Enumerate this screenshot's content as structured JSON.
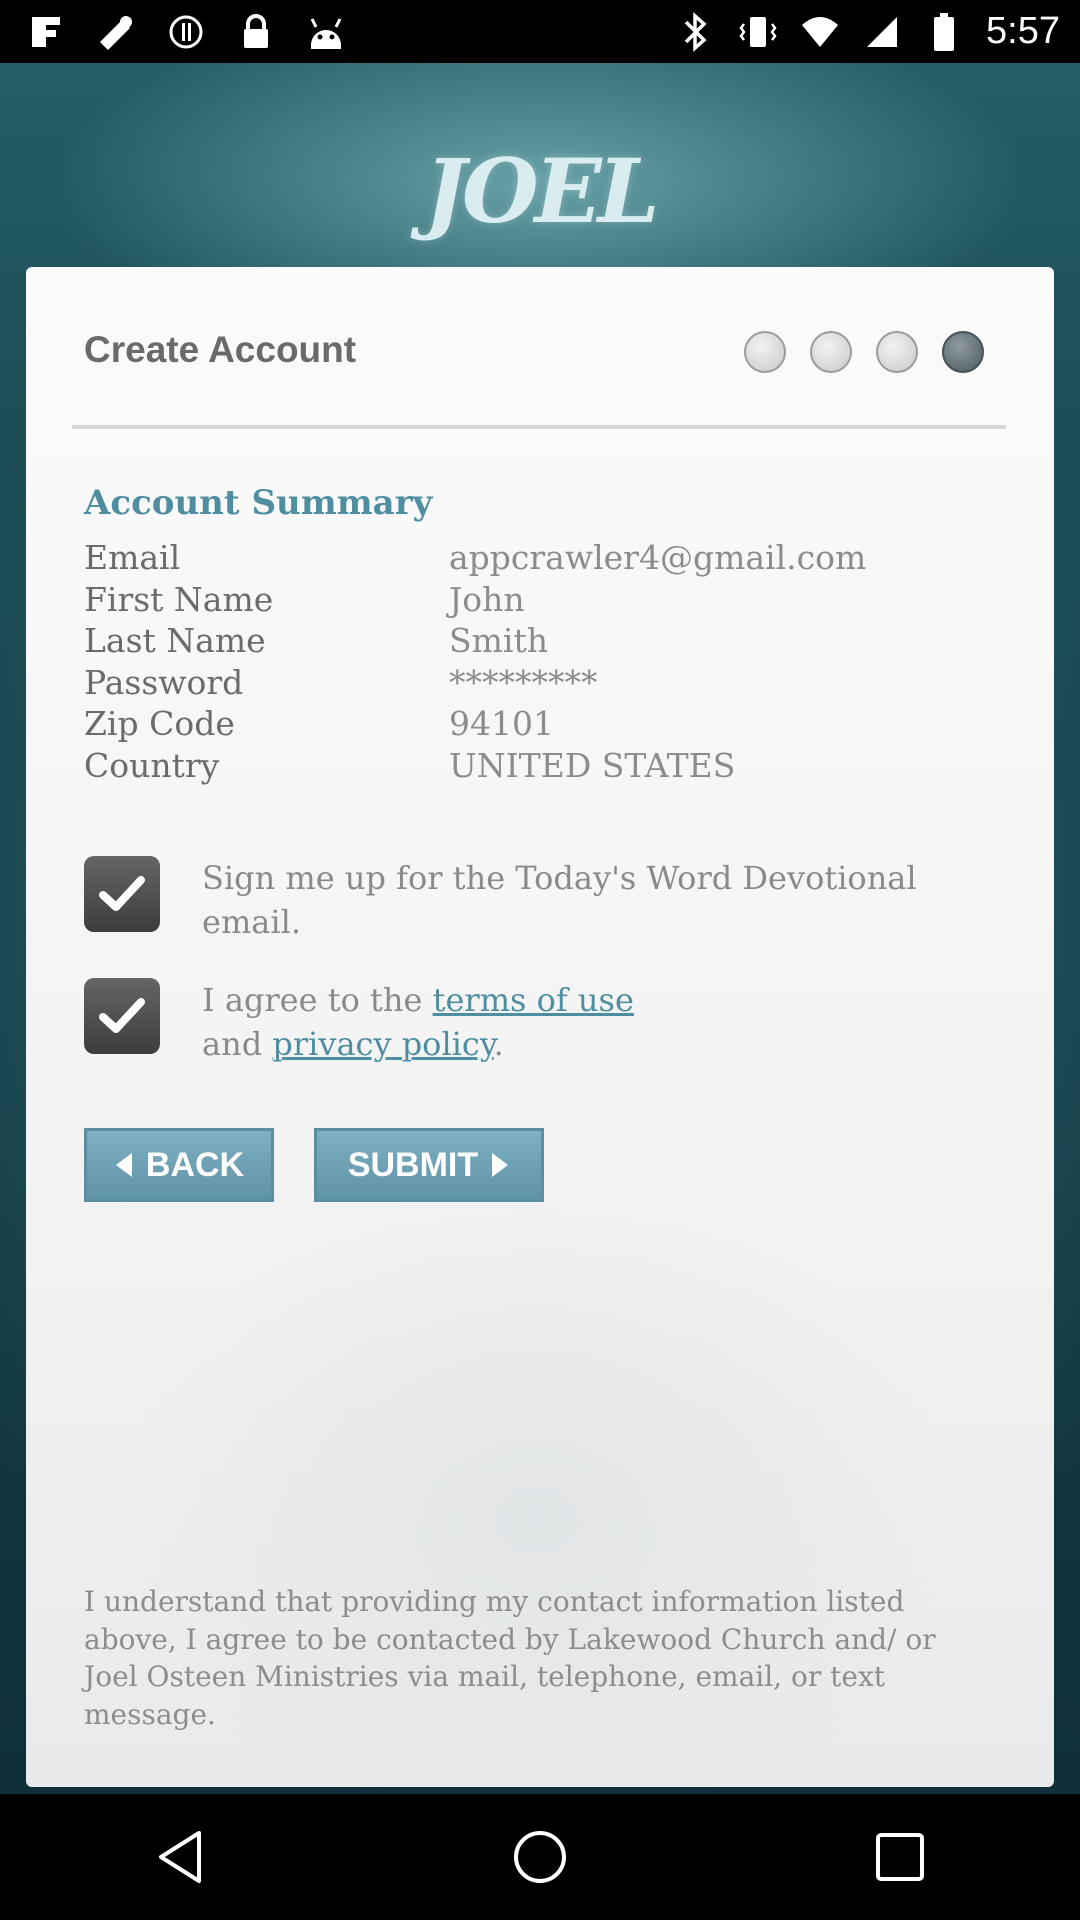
{
  "status_bar": {
    "time": "5:57"
  },
  "app": {
    "logo_text": "JOEL"
  },
  "header": {
    "title": "Create Account",
    "steps_total": 4,
    "current_step": 4
  },
  "summary": {
    "heading": "Account Summary",
    "rows": [
      {
        "label": "Email",
        "value": "appcrawler4@gmail.com"
      },
      {
        "label": "First Name",
        "value": "John"
      },
      {
        "label": "Last Name",
        "value": "Smith"
      },
      {
        "label": "Password",
        "value": "*********"
      },
      {
        "label": "Zip Code",
        "value": "94101"
      },
      {
        "label": "Country",
        "value": "UNITED STATES"
      }
    ]
  },
  "options": {
    "devotional_text": "Sign me up for the Today's Word Devotional email.",
    "devotional_checked": true,
    "terms_prefix": "I agree to the ",
    "terms_link": "terms of use",
    "terms_middle": "and ",
    "privacy_link": "privacy policy",
    "terms_suffix": ".",
    "terms_checked": true
  },
  "buttons": {
    "back_label": "BACK",
    "submit_label": "SUBMIT"
  },
  "disclaimer": "I understand that providing my contact information listed above, I agree to be contacted by Lakewood Church and/ or Joel Osteen Ministries via mail, telephone, email, or text message.",
  "colors": {
    "accent": "#4e8ea0",
    "button": "#6fa3b7"
  }
}
